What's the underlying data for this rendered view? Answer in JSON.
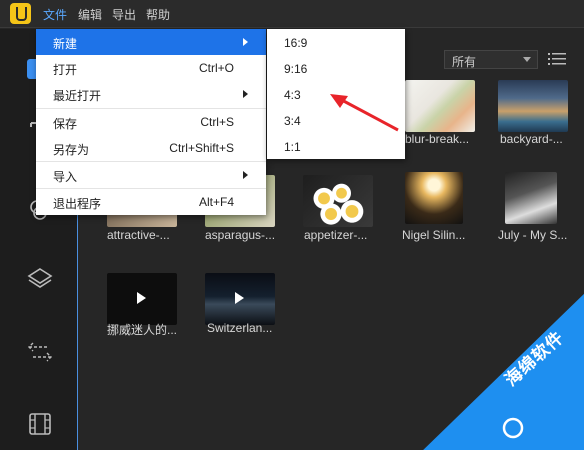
{
  "menubar": {
    "items": [
      {
        "label": "文件"
      },
      {
        "label": "编辑"
      },
      {
        "label": "导出"
      },
      {
        "label": "帮助"
      }
    ]
  },
  "filter": {
    "selected": "所有"
  },
  "file_menu": {
    "items": [
      {
        "label": "新建",
        "shortcut": ""
      },
      {
        "label": "打开",
        "shortcut": "Ctrl+O"
      },
      {
        "label": "最近打开",
        "shortcut": ""
      },
      {
        "label": "保存",
        "shortcut": "Ctrl+S"
      },
      {
        "label": "另存为",
        "shortcut": "Ctrl+Shift+S"
      },
      {
        "label": "导入",
        "shortcut": ""
      },
      {
        "label": "退出程序",
        "shortcut": "Alt+F4"
      }
    ]
  },
  "submenu": {
    "items": [
      {
        "label": "16:9"
      },
      {
        "label": "9:16"
      },
      {
        "label": "4:3"
      },
      {
        "label": "3:4"
      },
      {
        "label": "1:1"
      }
    ]
  },
  "media": {
    "items": [
      {
        "label": "blur-break..."
      },
      {
        "label": "backyard-..."
      },
      {
        "label": "attractive-..."
      },
      {
        "label": "asparagus-..."
      },
      {
        "label": "appetizer-..."
      },
      {
        "label": "Nigel Silin..."
      },
      {
        "label": "July - My S..."
      },
      {
        "label": "挪威迷人的..."
      },
      {
        "label": "Switzerlan..."
      }
    ]
  },
  "watermark": {
    "text": "海绵软件"
  },
  "colors": {
    "accent": "#1e73e8",
    "menu_active": "#5aa8ff",
    "annotation": "#e8242a",
    "watermark": "#1e8ff0"
  }
}
